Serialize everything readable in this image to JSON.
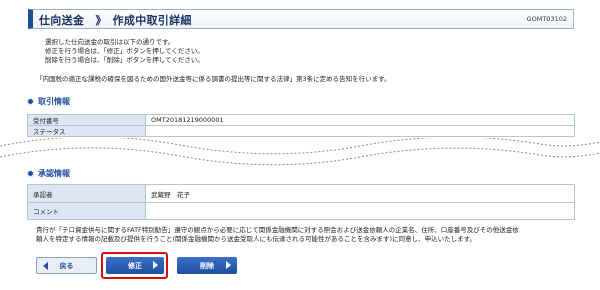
{
  "header": {
    "title": "仕向送金　》　作成中取引詳細",
    "screen_id": "GOMT03102"
  },
  "notes": [
    "選択した仕向送金の取引は以下の通りです。",
    "修正を行う場合は、「修正」ボタンを押してください。",
    "削除を行う場合は、「削除」ボタンを押してください。"
  ],
  "law_note": "「内国税の適正な課税の確保を図るための国外送金等に係る調書の提出等に関する法律」第3条に定める告知を行います。",
  "transaction_section": {
    "heading": "取引情報",
    "rows": [
      {
        "label": "受付番号",
        "value": "OMT20181219000001"
      },
      {
        "label": "ステータス",
        "value": ""
      }
    ]
  },
  "approval_section": {
    "heading": "承認情報",
    "rows": [
      {
        "label": "承認者",
        "value": "武蔵野　花子"
      },
      {
        "label": "コメント",
        "value": ""
      }
    ]
  },
  "disclaimer": [
    "貴行が「テロ資金供与に関するFATF特別勧告」遵守の観点から必要に応じて関係金融機関に対する照会および送金依頼人の企業名、住所、口座番号及びその他送金依",
    "頼人を特定する情報の記載及び提供を行うこと(関係金融機関から送金受取人にも伝達される可能性があることを含みます)に同意し、申込いたします。"
  ],
  "buttons": {
    "back": "戻る",
    "edit": "修正",
    "delete": "削除"
  },
  "colors": {
    "accent": "#1f4f9a",
    "label_bg": "#dde7f3",
    "highlight": "#d81010"
  }
}
